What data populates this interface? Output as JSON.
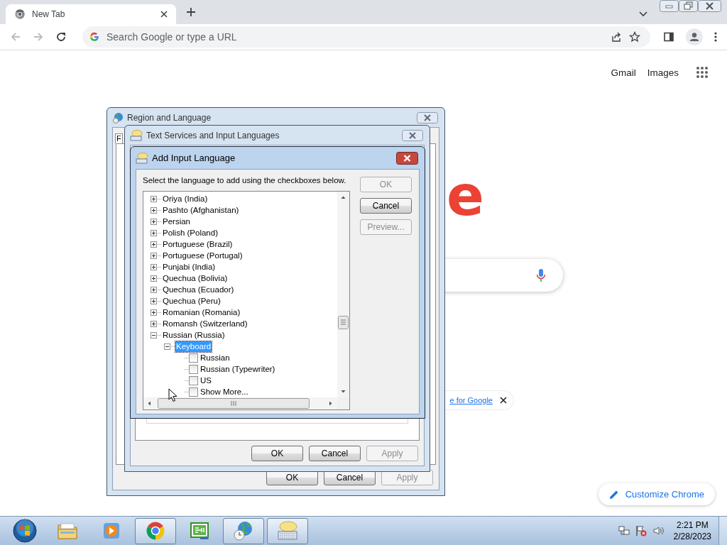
{
  "browser": {
    "tab": {
      "title": "New Tab"
    },
    "back": {
      "disabled": true
    },
    "forward": {
      "disabled": true
    },
    "address": {
      "placeholder": "Search Google or type a URL"
    }
  },
  "page": {
    "links": [
      "Gmail",
      "Images"
    ],
    "logo_fragment": "e",
    "promo_link": "e for Google",
    "customize_button": "Customize Chrome"
  },
  "region_window": {
    "title": "Region and Language",
    "tab_fragment": "F",
    "buttons": [
      {
        "label": "OK",
        "disabled": false
      },
      {
        "label": "Cancel",
        "disabled": false
      },
      {
        "label": "Apply",
        "disabled": true
      }
    ]
  },
  "text_services_window": {
    "title": "Text Services and Input Languages",
    "buttons": [
      {
        "label": "OK",
        "disabled": false
      },
      {
        "label": "Cancel",
        "disabled": false
      },
      {
        "label": "Apply",
        "disabled": true
      }
    ]
  },
  "add_input_language": {
    "title": "Add Input Language",
    "instruction": "Select the language to add using the checkboxes below.",
    "tree": [
      {
        "kind": "language",
        "label": "Oriya (India)",
        "expanded": false,
        "selected": false
      },
      {
        "kind": "language",
        "label": "Pashto (Afghanistan)",
        "expanded": false,
        "selected": false
      },
      {
        "kind": "language",
        "label": "Persian",
        "expanded": false,
        "selected": false
      },
      {
        "kind": "language",
        "label": "Polish (Poland)",
        "expanded": false,
        "selected": false
      },
      {
        "kind": "language",
        "label": "Portuguese (Brazil)",
        "expanded": false,
        "selected": false
      },
      {
        "kind": "language",
        "label": "Portuguese (Portugal)",
        "expanded": false,
        "selected": false
      },
      {
        "kind": "language",
        "label": "Punjabi (India)",
        "expanded": false,
        "selected": false
      },
      {
        "kind": "language",
        "label": "Quechua (Bolivia)",
        "expanded": false,
        "selected": false
      },
      {
        "kind": "language",
        "label": "Quechua (Ecuador)",
        "expanded": false,
        "selected": false
      },
      {
        "kind": "language",
        "label": "Quechua (Peru)",
        "expanded": false,
        "selected": false
      },
      {
        "kind": "language",
        "label": "Romanian (Romania)",
        "expanded": false,
        "selected": false
      },
      {
        "kind": "language",
        "label": "Romansh (Switzerland)",
        "expanded": false,
        "selected": false
      },
      {
        "kind": "language",
        "label": "Russian (Russia)",
        "expanded": true,
        "selected": false,
        "children": [
          {
            "kind": "category",
            "label": "Keyboard",
            "expanded": true,
            "selected": true,
            "children": [
              {
                "kind": "layout",
                "label": "Russian",
                "checked": false,
                "selected": false
              },
              {
                "kind": "layout",
                "label": "Russian (Typewriter)",
                "checked": false,
                "selected": false
              },
              {
                "kind": "layout",
                "label": "US",
                "checked": false,
                "selected": false
              },
              {
                "kind": "layout",
                "label": "Show More...",
                "checked": false,
                "selected": false
              }
            ]
          }
        ]
      }
    ],
    "buttons": [
      {
        "label": "OK",
        "disabled": true
      },
      {
        "label": "Cancel",
        "disabled": false
      },
      {
        "label": "Preview...",
        "disabled": true
      }
    ]
  },
  "taskbar": {
    "items": [
      {
        "kind": "explorer",
        "running": false
      },
      {
        "kind": "media",
        "running": false
      },
      {
        "kind": "chrome",
        "running": true
      },
      {
        "kind": "csharp",
        "running": false
      },
      {
        "kind": "region",
        "running": true
      },
      {
        "kind": "keyboard",
        "running": true
      }
    ],
    "clock": {
      "time": "2:21 PM",
      "date": "2/28/2023"
    }
  }
}
